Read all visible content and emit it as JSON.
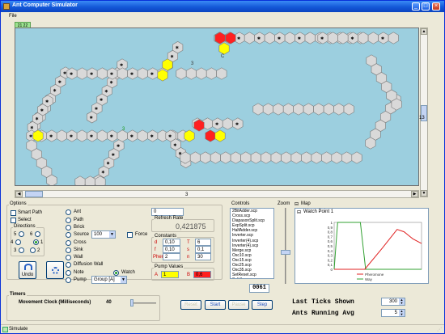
{
  "window": {
    "title": "Ant Computer Simulator",
    "minimize": "_",
    "maximize": "□",
    "close": "×"
  },
  "menu": {
    "file": "File"
  },
  "board": {
    "counter": "21 22",
    "hscroll_value": "3",
    "vscroll_value": "13",
    "status_labels": [
      "3",
      "C",
      "3"
    ]
  },
  "options": {
    "title": "Options",
    "smart_path": "Smart Path",
    "select": "Select",
    "directions_title": "Directions",
    "directions": [
      "5",
      "6",
      "4",
      "1",
      "3",
      "2"
    ],
    "selected_direction": "1",
    "undo": "Undo",
    "tools": [
      "Ant",
      "Path",
      "Brick",
      "Source",
      "Cross",
      "Sink",
      "Wall",
      "Diffusion Wall",
      "Note",
      "Pump"
    ],
    "source_value": "100",
    "force": "Force",
    "watch": "Watch",
    "pump_group": "Group [A]"
  },
  "rates": {
    "input_value": "0",
    "refresh_label": "Refresh Rate",
    "refresh_value": "0,421875"
  },
  "constants": {
    "title": "Constants",
    "rows": [
      {
        "left_label": "d",
        "left_value": "0,10",
        "right_label": "T",
        "right_value": "6"
      },
      {
        "left_label": "f",
        "left_value": "0,10",
        "right_label": "s",
        "right_value": "0,1"
      },
      {
        "left_label": "Pher",
        "left_value": "2",
        "right_label": "n",
        "right_value": "30"
      }
    ]
  },
  "pump_values": {
    "title": "Pump Values",
    "a_label": "A",
    "a_value": "1",
    "b_label": "B",
    "b_value": "0,6"
  },
  "controls": {
    "title": "Controls",
    "items": [
      "2BitAdder.scp",
      "Cross.scp",
      "DiapasonSplit.scp",
      "ExpSplit.scp",
      "HalfAdder.scp",
      "Inverter.scp",
      "Inverter(4).scp",
      "Inverter(4).scp",
      "Merge.scp",
      "Osc10.scp",
      "Osc15.scp",
      "Osc25.scp",
      "Osc35.scp",
      "SetReset.scp",
      "Split1.scp",
      "Split3.scp"
    ]
  },
  "zoom": {
    "title": "Zoom"
  },
  "map": {
    "title": "Map",
    "watch_point": "Watch Point 1",
    "y_ticks": [
      "1",
      "0,9",
      "0,8",
      "0,7",
      "0,6",
      "0,5",
      "0,4",
      "0,3",
      "0,2",
      "0,1",
      "0"
    ],
    "y2_ticks": [
      "1",
      "0,8",
      "0,6",
      "0,4",
      "0,2",
      "0"
    ],
    "legend": [
      "Pheromone",
      "Way"
    ],
    "colors": {
      "pheromone": "#e02020",
      "way": "#30a030"
    }
  },
  "timers": {
    "title": "Timers",
    "movement_label": "Movement Clock (Milliseconds)",
    "movement_value": "40"
  },
  "ticks_display": "0061",
  "buttons": {
    "reset": "Reset",
    "start": "Start",
    "pause": "Pause",
    "step": "Step"
  },
  "stats": {
    "last_ticks_label": "Last Ticks Shown",
    "last_ticks_value": "300",
    "ants_avg_label": "Ants Running Avg",
    "ants_avg_value": "5"
  },
  "status": {
    "text": "Simulate"
  }
}
